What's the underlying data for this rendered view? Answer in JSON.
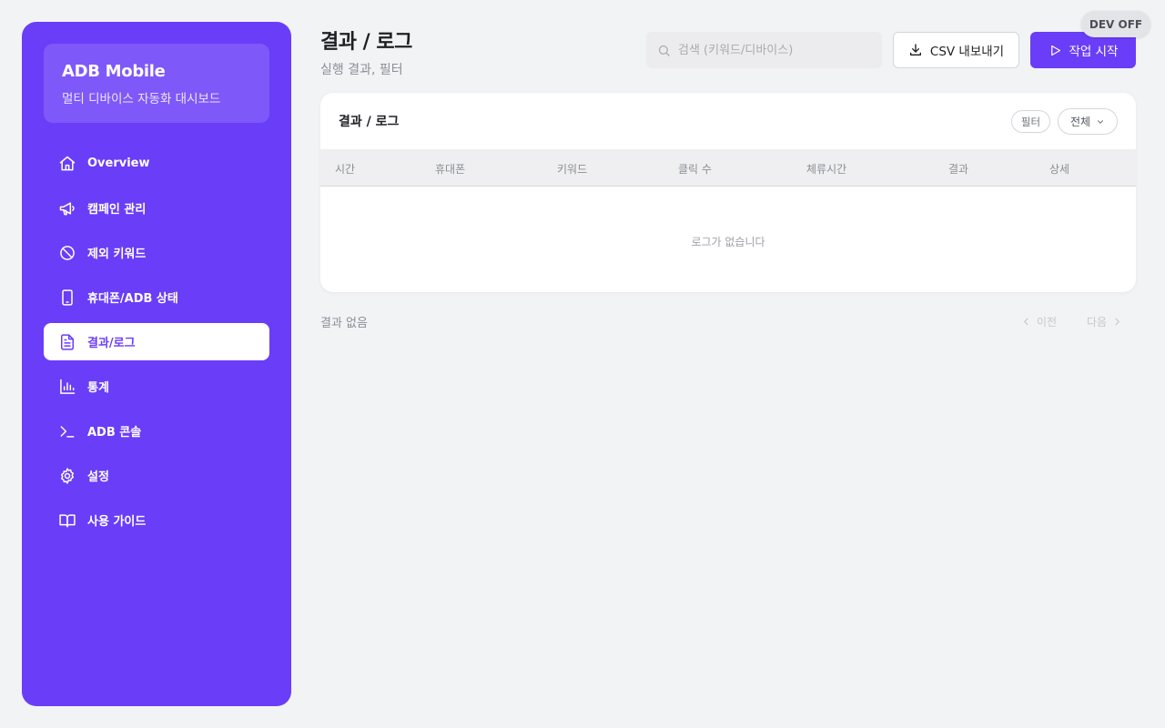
{
  "sidebar": {
    "brand_title": "ADB Mobile",
    "brand_subtitle": "멀티 디바이스 자동화 대시보드",
    "items": [
      {
        "label": "Overview",
        "icon": "home-icon"
      },
      {
        "label": "캠페인 관리",
        "icon": "megaphone-icon"
      },
      {
        "label": "제외 키워드",
        "icon": "ban-icon"
      },
      {
        "label": "휴대폰/ADB 상태",
        "icon": "phone-icon"
      },
      {
        "label": "결과/로그",
        "icon": "document-icon",
        "active": true
      },
      {
        "label": "통계",
        "icon": "bar-chart-icon"
      },
      {
        "label": "ADB 콘솔",
        "icon": "terminal-icon"
      },
      {
        "label": "설정",
        "icon": "gear-icon"
      },
      {
        "label": "사용 가이드",
        "icon": "book-icon"
      }
    ]
  },
  "header": {
    "title": "결과 / 로그",
    "subtitle": "실행 결과, 필터",
    "search_placeholder": "검색 (키워드/디바이스)",
    "csv_label": "CSV 내보내기",
    "start_label": "작업 시작",
    "dev_badge": "DEV OFF"
  },
  "card": {
    "title": "결과 / 로그",
    "filter_label": "필터",
    "select_value": "전체",
    "columns": [
      "시간",
      "휴대폰",
      "키워드",
      "클릭 수",
      "체류시간",
      "결과",
      "상세"
    ],
    "empty_text": "로그가 없습니다"
  },
  "footer": {
    "count_text": "결과 없음",
    "prev_label": "이전",
    "next_label": "다음"
  },
  "colors": {
    "accent": "#6a3df8",
    "background": "#f2f3f5"
  }
}
